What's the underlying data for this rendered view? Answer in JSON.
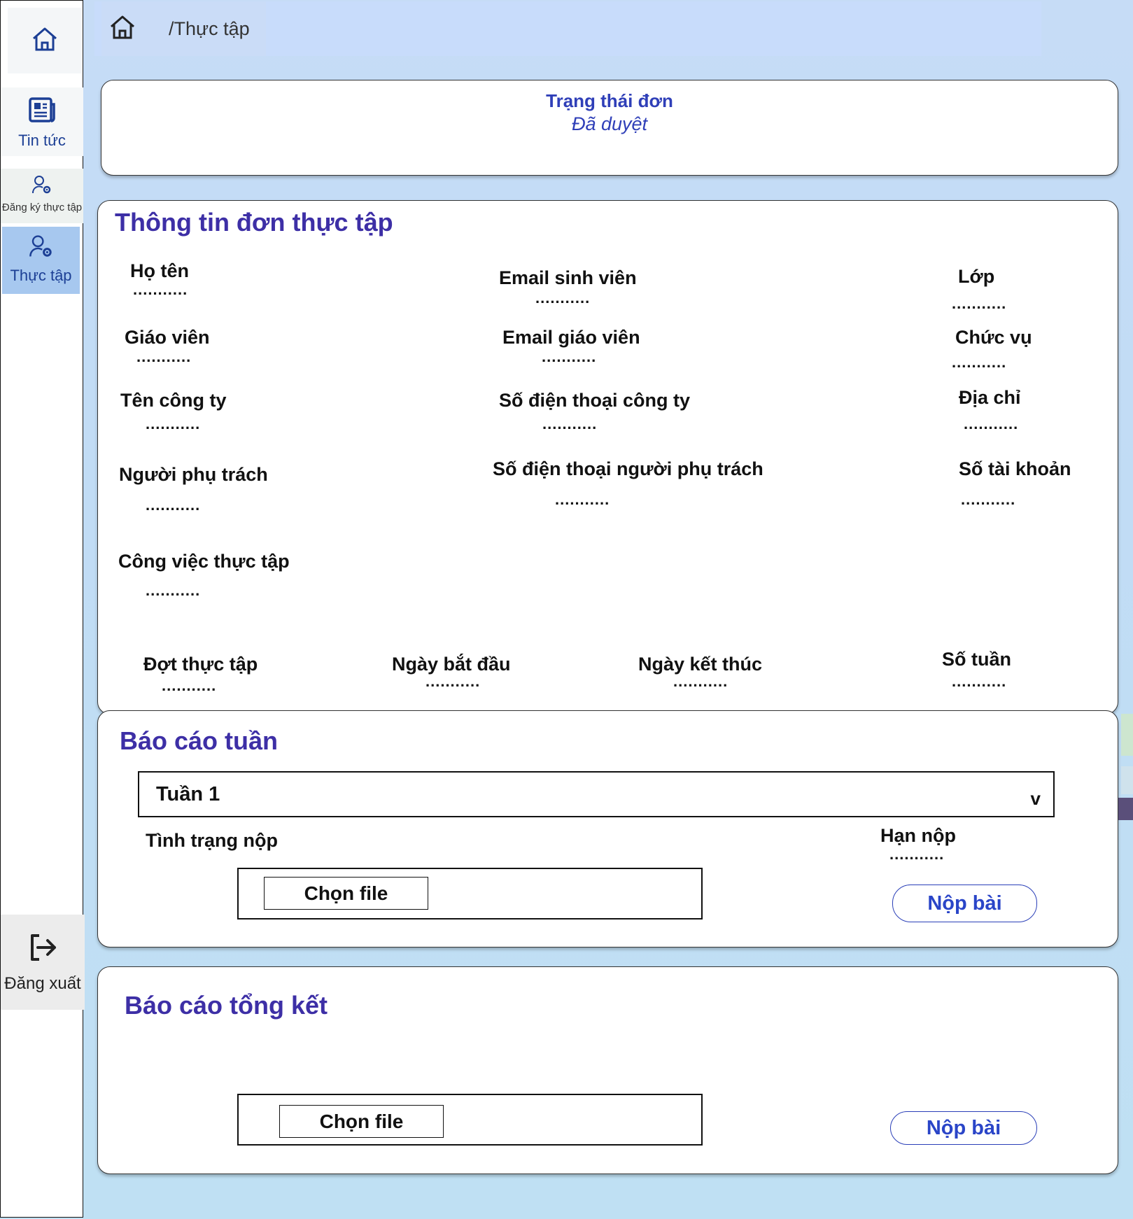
{
  "sidebar": {
    "home_icon": "home-icon",
    "items": [
      {
        "label": "Tin tức",
        "icon": "newspaper-icon"
      },
      {
        "label": "Đăng ký thực tập",
        "icon": "user-gear-icon"
      },
      {
        "label": "Thực tập",
        "icon": "user-gear-icon",
        "active": true
      }
    ],
    "logout": {
      "label": "Đăng xuất",
      "icon": "logout-icon"
    }
  },
  "breadcrumb": {
    "home_icon": "home-icon",
    "path": "/Thực tập"
  },
  "status": {
    "title": "Trạng thái đơn",
    "value": "Đã duyệt"
  },
  "info": {
    "title": "Thông tin đơn thực tập",
    "placeholder": "...........",
    "fields": {
      "ho_ten": "Họ tên",
      "email_sv": "Email sinh viên",
      "lop": "Lớp",
      "giao_vien": "Giáo viên",
      "email_gv": "Email giáo viên",
      "chuc_vu": "Chức vụ",
      "ten_cong_ty": "Tên công ty",
      "sdt_cong_ty": "Số điện thoại công ty",
      "dia_chi": "Địa chỉ",
      "nguoi_phu_trach": "Người phụ trách",
      "sdt_nguoi_phu_trach": "Số điện thoại người phụ trách",
      "so_tai_khoan": "Số tài khoản",
      "cong_viec": "Công việc thực tập",
      "dot_thuc_tap": "Đợt thực tập",
      "ngay_bat_dau": "Ngày bắt đầu",
      "ngay_ket_thuc": "Ngày kết thúc",
      "so_tuan": "Số tuần"
    }
  },
  "weekly": {
    "title": "Báo cáo tuần",
    "selected_week": "Tuần 1",
    "status_label": "Tình trạng nộp",
    "deadline_label": "Hạn nộp",
    "deadline_value": "...........",
    "choose_file": "Chọn file",
    "submit": "Nộp bài"
  },
  "final": {
    "title": "Báo cáo tổng kết",
    "choose_file": "Chọn file",
    "submit": "Nộp bài"
  },
  "colors": {
    "accent": "#2f3fb8",
    "title": "#3d2fa6",
    "sidebar_active": "#a7c8ef"
  }
}
